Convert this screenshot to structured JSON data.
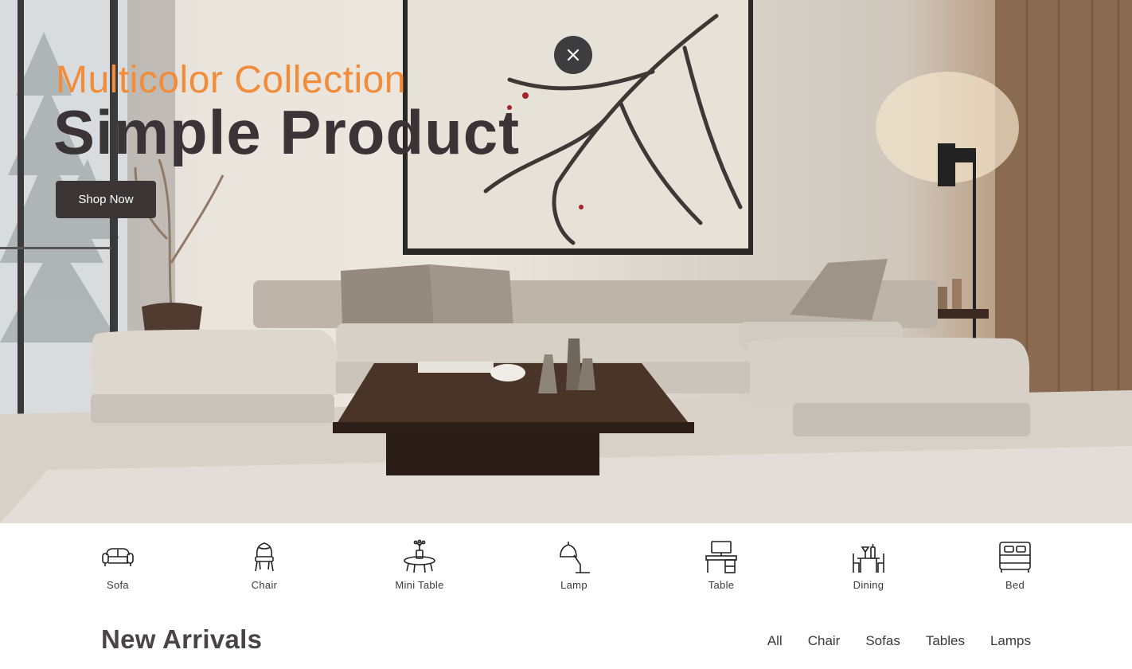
{
  "hero": {
    "subtitle": "Multicolor Collection",
    "title": "Simple Product",
    "cta_label": "Shop Now",
    "close_icon": "close-icon"
  },
  "categories": [
    {
      "label": "Sofa",
      "icon": "sofa-icon"
    },
    {
      "label": "Chair",
      "icon": "chair-icon"
    },
    {
      "label": "Mini Table",
      "icon": "mini-table-icon"
    },
    {
      "label": "Lamp",
      "icon": "lamp-icon"
    },
    {
      "label": "Table",
      "icon": "desk-icon"
    },
    {
      "label": "Dining",
      "icon": "dining-icon"
    },
    {
      "label": "Bed",
      "icon": "bed-icon"
    }
  ],
  "arrivals": {
    "title": "New Arrivals",
    "filters": [
      "All",
      "Chair",
      "Sofas",
      "Tables",
      "Lamps"
    ]
  },
  "colors": {
    "accent": "#f08c3a",
    "dark": "#3b3536"
  }
}
